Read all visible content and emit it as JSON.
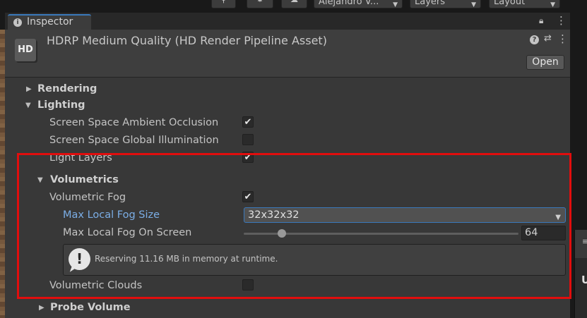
{
  "toolbar": {
    "account_label": "Alejandro V...",
    "layers_label": "Layers",
    "layout_label": "Layout"
  },
  "tab": {
    "label": "Inspector"
  },
  "header": {
    "icon_text": "HD",
    "title": "HDRP Medium Quality (HD Render Pipeline Asset)",
    "open_label": "Open"
  },
  "sections": {
    "rendering": "Rendering",
    "lighting": "Lighting",
    "volumetrics": "Volumetrics",
    "probe_volume": "Probe Volume"
  },
  "props": {
    "ssao": {
      "label": "Screen Space Ambient Occlusion",
      "checked": true
    },
    "ssgi": {
      "label": "Screen Space Global Illumination",
      "checked": false
    },
    "light_layers": {
      "label": "Light Layers",
      "checked": true
    },
    "volumetric_fog": {
      "label": "Volumetric Fog",
      "checked": true
    },
    "max_local_fog_size": {
      "label": "Max Local Fog Size",
      "value": "32x32x32"
    },
    "max_local_fog_on_screen": {
      "label": "Max Local Fog On Screen",
      "value": "64",
      "fraction": 0.14
    },
    "volumetric_clouds": {
      "label": "Volumetric Clouds",
      "checked": false
    }
  },
  "helpbox": {
    "text": "Reserving 11.16 MB in memory at runtime."
  },
  "right_panel": {
    "letter": "U"
  },
  "colors": {
    "highlight": "#e10d0d",
    "accent": "#3a79bb",
    "active_label": "#7baee6"
  }
}
